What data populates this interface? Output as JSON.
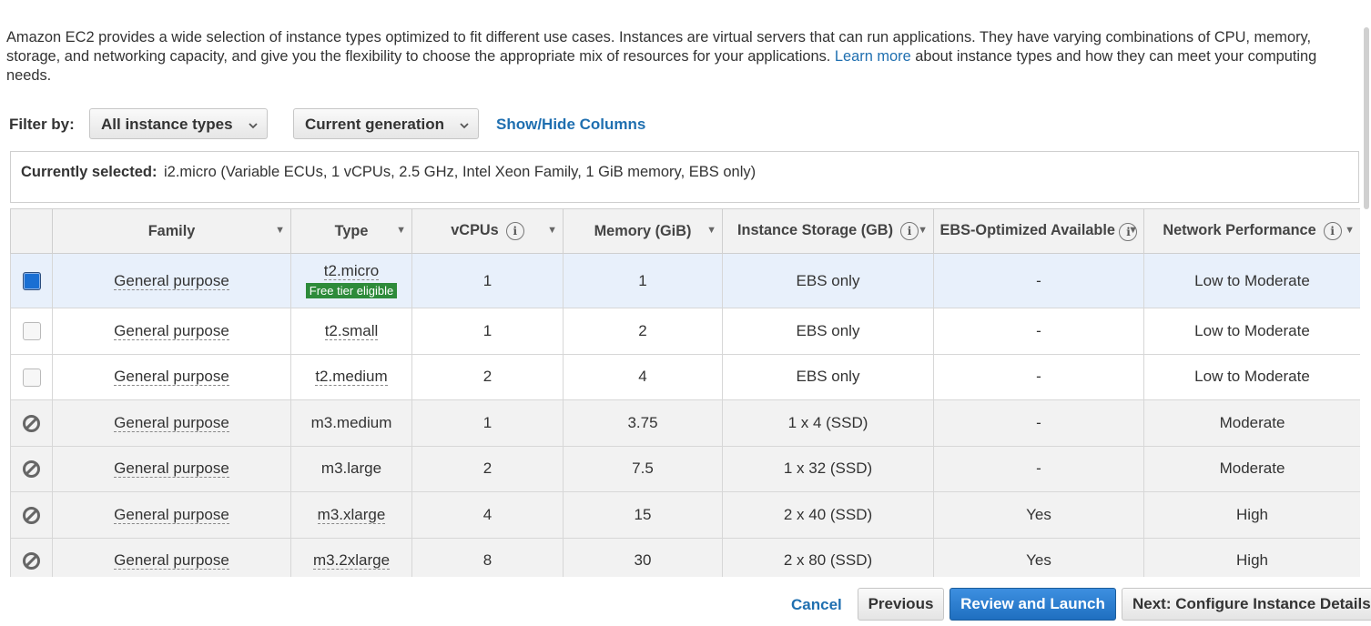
{
  "intro": {
    "text_before": "Amazon EC2 provides a wide selection of instance types optimized to fit different use cases. Instances are virtual servers that can run applications. They have varying combinations of CPU, memory, storage, and networking capacity, and give you the flexibility to choose the appropriate mix of resources for your applications.",
    "link": "Learn more",
    "text_after": "about instance types and how they can meet your computing needs."
  },
  "filter": {
    "label": "Filter by:",
    "instance_types_selected": "All instance types",
    "generation_selected": "Current generation",
    "show_hide": "Show/Hide Columns"
  },
  "selected": {
    "label": "Currently selected:",
    "value": "i2.micro (Variable ECUs, 1 vCPUs, 2.5 GHz, Intel Xeon Family, 1 GiB memory, EBS only)"
  },
  "table": {
    "headers": {
      "family": "Family",
      "type": "Type",
      "vcpus": "vCPUs",
      "memory": "Memory (GiB)",
      "storage": "Instance Storage (GB)",
      "ebs": "EBS-Optimized Available",
      "network": "Network Performance"
    },
    "rows": [
      {
        "family": "General purpose",
        "type": "t2.micro",
        "badge": "Free tier eligible",
        "vcpus": "1",
        "memory": "1",
        "storage": "EBS only",
        "ebs": "-",
        "network": "Low to Moderate"
      },
      {
        "family": "General purpose",
        "type": "t2.small",
        "vcpus": "1",
        "memory": "2",
        "storage": "EBS only",
        "ebs": "-",
        "network": "Low to Moderate"
      },
      {
        "family": "General purpose",
        "type": "t2.medium",
        "vcpus": "2",
        "memory": "4",
        "storage": "EBS only",
        "ebs": "-",
        "network": "Low to Moderate"
      },
      {
        "family": "General purpose",
        "type": "m3.medium",
        "vcpus": "1",
        "memory": "3.75",
        "storage": "1 x 4 (SSD)",
        "ebs": "-",
        "network": "Moderate"
      },
      {
        "family": "General purpose",
        "type": "m3.large",
        "vcpus": "2",
        "memory": "7.5",
        "storage": "1 x 32 (SSD)",
        "ebs": "-",
        "network": "Moderate"
      },
      {
        "family": "General purpose",
        "type": "m3.xlarge",
        "vcpus": "4",
        "memory": "15",
        "storage": "2 x 40 (SSD)",
        "ebs": "Yes",
        "network": "High"
      },
      {
        "family": "General purpose",
        "type": "m3.2xlarge",
        "vcpus": "8",
        "memory": "30",
        "storage": "2 x 80 (SSD)",
        "ebs": "Yes",
        "network": "High"
      }
    ]
  },
  "footer": {
    "cancel": "Cancel",
    "previous": "Previous",
    "review": "Review and Launch",
    "next": "Next: Configure Instance Details"
  },
  "colors": {
    "link": "#1f6fb0",
    "primary_button": "#1f6fc0",
    "free_badge": "#2e8b3a",
    "selected_row": "#e8f0fb"
  }
}
